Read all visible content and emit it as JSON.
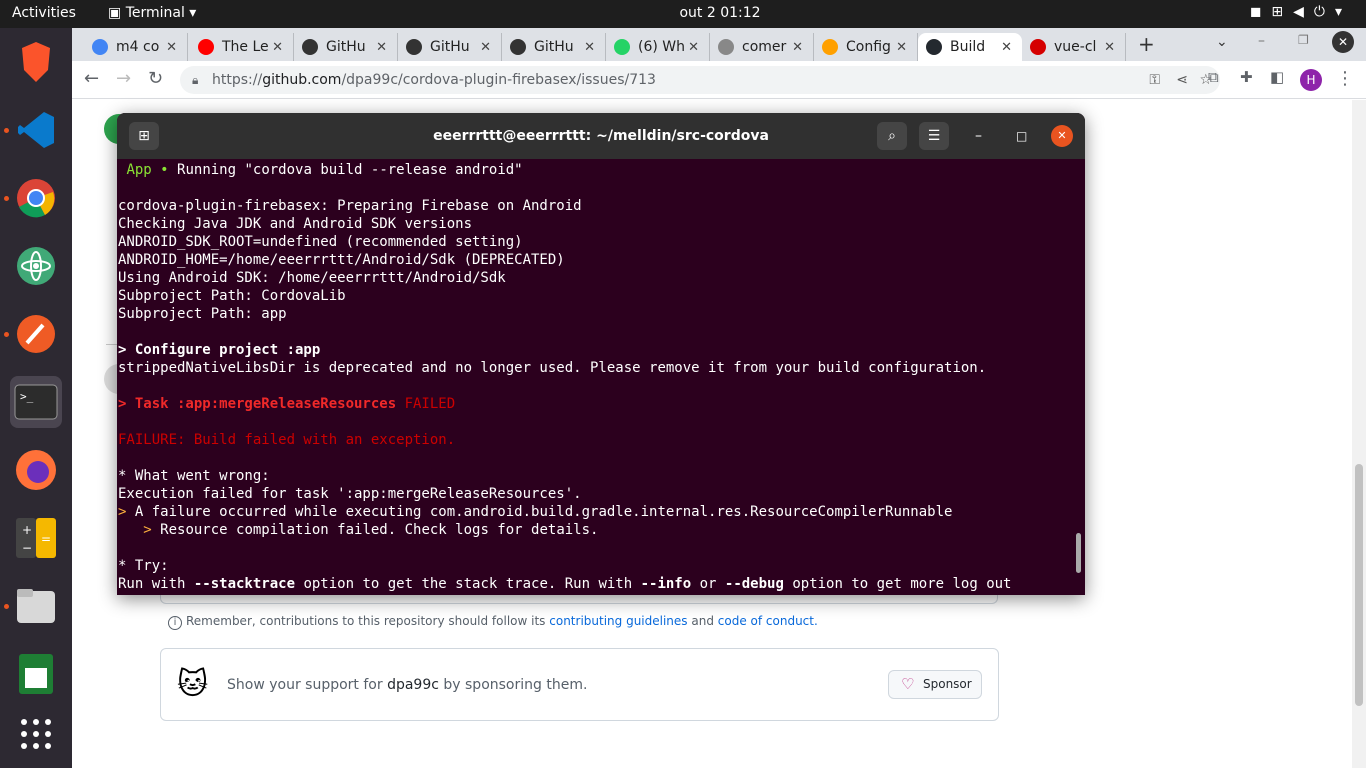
{
  "topbar": {
    "activities": "Activities",
    "app": "Terminal",
    "clock": "out 2  01:12"
  },
  "tabs": [
    {
      "label": "m4 co",
      "color": "#4285f4"
    },
    {
      "label": "The Le",
      "color": "#ff0000"
    },
    {
      "label": "GitHu",
      "color": "#333333"
    },
    {
      "label": "GitHu",
      "color": "#333333"
    },
    {
      "label": "GitHu",
      "color": "#333333"
    },
    {
      "label": "(6) Wh",
      "color": "#25d366"
    },
    {
      "label": "comer",
      "color": "#888888"
    },
    {
      "label": "Config",
      "color": "#ffa000"
    },
    {
      "label": "Build",
      "color": "#24292f"
    },
    {
      "label": "vue-cl",
      "color": "#d50000"
    }
  ],
  "browser": {
    "url_prefix": "https://",
    "url_host": "github.com",
    "url_path": "/dpa99c/cordova-plugin-firebasex/issues/713",
    "profile": "H"
  },
  "terminal": {
    "title": "eeerrrttt@eeerrrttt: ~/melldin/src-cordova",
    "lines": [
      {
        "t": " App • Running \"cordova build --release android\"",
        "c": ""
      },
      {
        "t": "",
        "c": ""
      },
      {
        "t": "cordova-plugin-firebasex: Preparing Firebase on Android",
        "c": ""
      },
      {
        "t": "Checking Java JDK and Android SDK versions",
        "c": ""
      },
      {
        "t": "ANDROID_SDK_ROOT=undefined (recommended setting)",
        "c": ""
      },
      {
        "t": "ANDROID_HOME=/home/eeerrrttt/Android/Sdk (DEPRECATED)",
        "c": ""
      },
      {
        "t": "Using Android SDK: /home/eeerrrttt/Android/Sdk",
        "c": ""
      },
      {
        "t": "Subproject Path: CordovaLib",
        "c": ""
      },
      {
        "t": "Subproject Path: app",
        "c": ""
      },
      {
        "t": "",
        "c": ""
      },
      {
        "t": "> Configure project :app",
        "c": "b"
      },
      {
        "t": "strippedNativeLibsDir is deprecated and no longer used. Please remove it from your build configuration.",
        "c": ""
      },
      {
        "t": "",
        "c": ""
      },
      {
        "t": "> Task :app:mergeReleaseResources FAILED",
        "c": "red"
      },
      {
        "t": "",
        "c": ""
      },
      {
        "t": "FAILURE: Build failed with an exception.",
        "c": "red"
      },
      {
        "t": "",
        "c": ""
      },
      {
        "t": "* What went wrong:",
        "c": ""
      },
      {
        "t": "Execution failed for task ':app:mergeReleaseResources'.",
        "c": ""
      },
      {
        "t": "> A failure occurred while executing com.android.build.gradle.internal.res.ResourceCompilerRunnable",
        "c": ""
      },
      {
        "t": "   > Resource compilation failed. Check logs for details.",
        "c": ""
      },
      {
        "t": "",
        "c": ""
      },
      {
        "t": "* Try:",
        "c": ""
      },
      {
        "t": "Run with --stacktrace option to get the stack trace. Run with --info or --debug option to get more log out",
        "c": ""
      }
    ]
  },
  "github": {
    "guidelines_prefix": "Remember, contributions to this repository should follow its",
    "guidelines_link": "contributing guidelines",
    "and": "and",
    "conduct_link": "code of conduct.",
    "support_prefix": "Show your support for",
    "support_user": "dpa99c",
    "support_suffix": "by sponsoring them.",
    "sponsor_label": "Sponsor"
  }
}
